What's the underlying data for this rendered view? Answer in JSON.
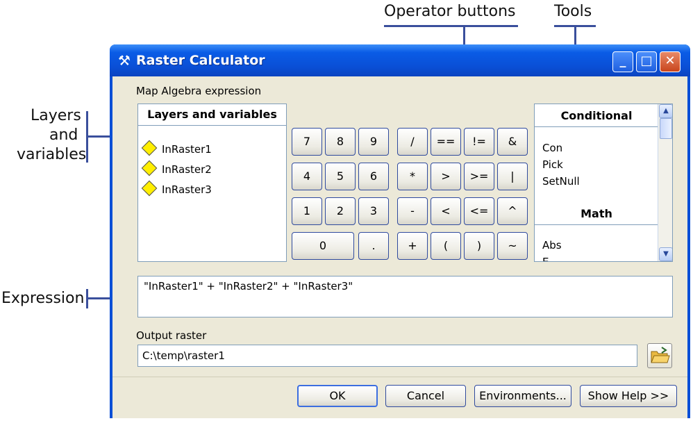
{
  "callouts": {
    "operator_buttons": "Operator buttons",
    "tools": "Tools",
    "layers_and_variables": [
      "Layers",
      "and",
      "variables"
    ],
    "expression": "Expression"
  },
  "window": {
    "title": "Raster Calculator",
    "icon": "hammer-icon",
    "controls": {
      "minimize": "_",
      "maximize": "□",
      "close": "✕"
    }
  },
  "map_algebra_label": "Map Algebra expression",
  "layers": {
    "header": "Layers and variables",
    "items": [
      "InRaster1",
      "InRaster2",
      "InRaster3"
    ]
  },
  "keypad": {
    "numbers": [
      "7",
      "8",
      "9",
      "4",
      "5",
      "6",
      "1",
      "2",
      "3",
      "0",
      "."
    ],
    "operators": [
      "/",
      "==",
      "!=",
      "&",
      "*",
      ">",
      ">=",
      "|",
      "-",
      "<",
      "<=",
      "^",
      "+",
      "(",
      ")",
      "~"
    ]
  },
  "tools": {
    "conditional_header": "Conditional",
    "conditional_items": [
      "Con",
      "Pick",
      "SetNull"
    ],
    "math_header": "Math",
    "math_items": [
      "Abs",
      "E"
    ]
  },
  "expression": "\"InRaster1\" + \"InRaster2\" + \"InRaster3\"",
  "output": {
    "label": "Output raster",
    "value": "C:\\temp\\raster1"
  },
  "buttons": {
    "ok": "OK",
    "cancel": "Cancel",
    "environments": "Environments...",
    "show_help": "Show Help >>"
  }
}
